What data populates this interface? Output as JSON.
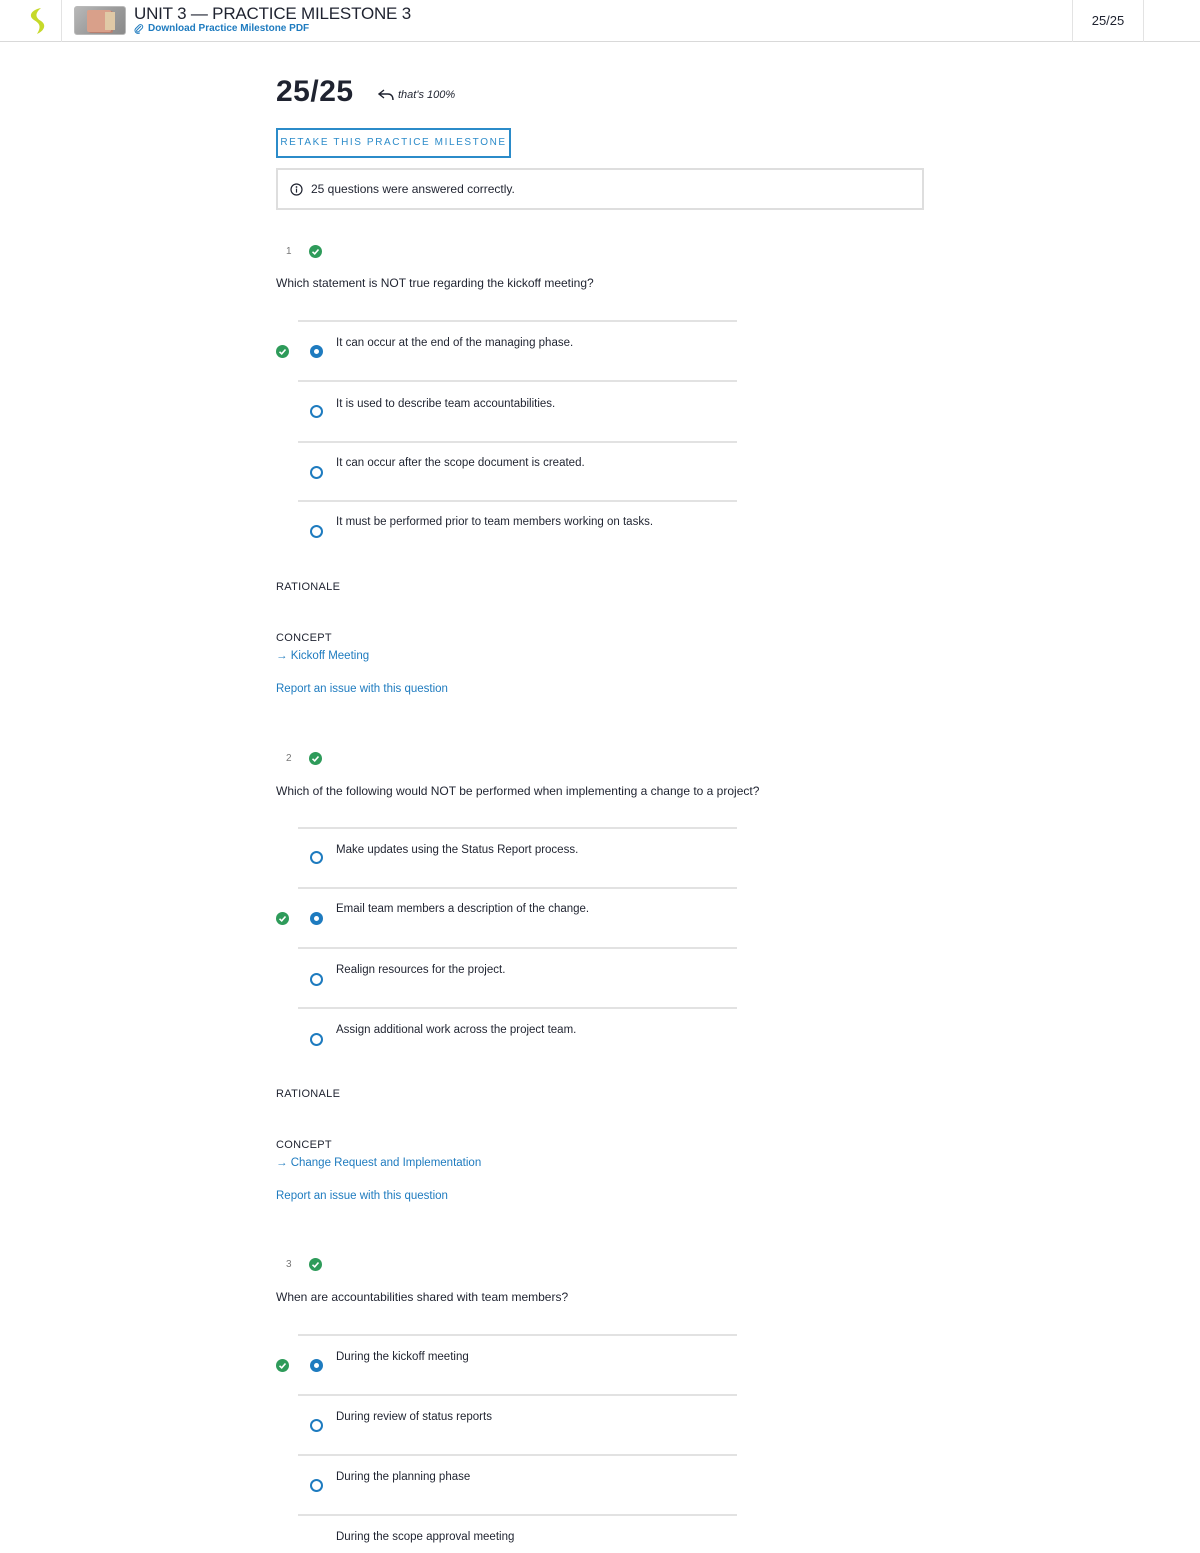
{
  "header": {
    "title": "UNIT 3 — PRACTICE MILESTONE 3",
    "download_label": "Download Practice Milestone PDF",
    "score": "25/25"
  },
  "result": {
    "score": "25/25",
    "note": "that's 100%",
    "retake_label": "RETAKE THIS PRACTICE MILESTONE",
    "summary": "25 questions were answered correctly."
  },
  "questions": [
    {
      "number": "1",
      "text": "Which statement is NOT true regarding the kickoff meeting?",
      "options": [
        "It can occur at the end of the managing phase.",
        "It is used to describe team accountabilities.",
        "It can occur after the scope document is created.",
        "It must be performed prior to team members working on tasks."
      ],
      "selected_index": 0,
      "rationale_label": "RATIONALE",
      "concept_label": "CONCEPT",
      "concept": "→ Kickoff Meeting",
      "report_label": "Report an issue with this question"
    },
    {
      "number": "2",
      "text": "Which of the following would NOT be performed when implementing a change to a project?",
      "options": [
        "Make updates using the Status Report process.",
        "Email team members a description of the change.",
        "Realign resources for the project.",
        "Assign additional work across the project team."
      ],
      "selected_index": 1,
      "rationale_label": "RATIONALE",
      "concept_label": "CONCEPT",
      "concept": "→ Change Request and Implementation",
      "report_label": "Report an issue with this question"
    },
    {
      "number": "3",
      "text": "When are accountabilities shared with team members?",
      "options": [
        "During the kickoff meeting",
        "During review of status reports",
        "During the planning phase",
        "During the scope approval meeting"
      ],
      "selected_index": 0
    }
  ],
  "colors": {
    "accent": "#1e7bbf",
    "correct": "#2e9b5a",
    "logo": "#c6d92a"
  }
}
